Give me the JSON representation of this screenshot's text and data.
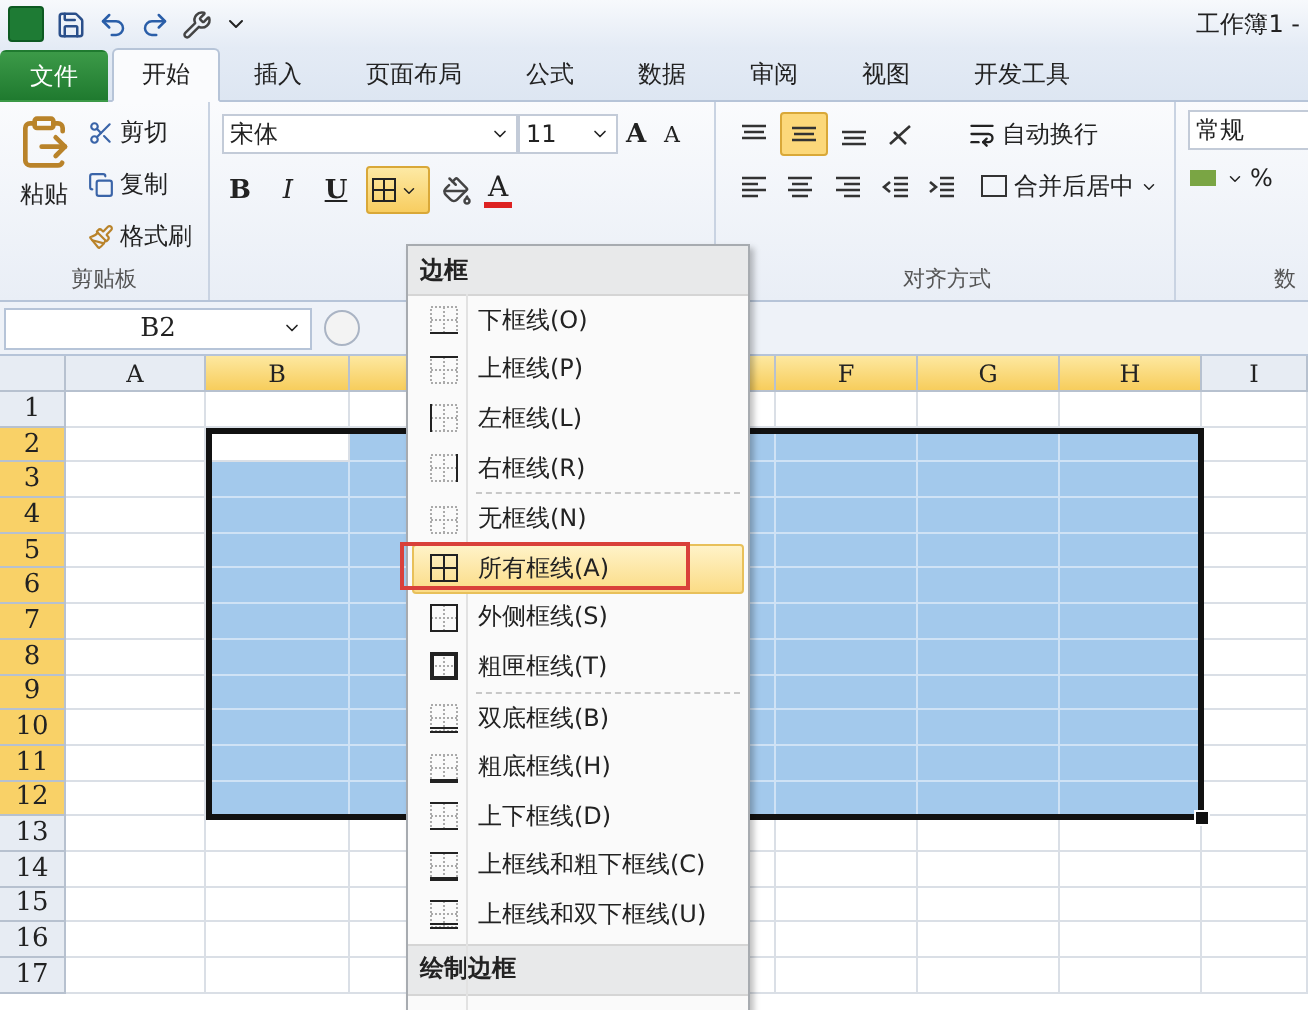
{
  "window": {
    "title": "工作簿1 -"
  },
  "tabs": [
    {
      "label": "文件",
      "kind": "file",
      "selected": false
    },
    {
      "label": "开始",
      "kind": "tab",
      "selected": true
    },
    {
      "label": "插入",
      "kind": "tab",
      "selected": false
    },
    {
      "label": "页面布局",
      "kind": "tab",
      "selected": false
    },
    {
      "label": "公式",
      "kind": "tab",
      "selected": false
    },
    {
      "label": "数据",
      "kind": "tab",
      "selected": false
    },
    {
      "label": "审阅",
      "kind": "tab",
      "selected": false
    },
    {
      "label": "视图",
      "kind": "tab",
      "selected": false
    },
    {
      "label": "开发工具",
      "kind": "tab",
      "selected": false
    }
  ],
  "ribbon": {
    "clipboard": {
      "paste": "粘贴",
      "cut": "剪切",
      "copy": "复制",
      "format_painter": "格式刷",
      "label": "剪贴板"
    },
    "font": {
      "name": "宋体",
      "size": "11",
      "grow": "A",
      "shrink": "A",
      "bold": "B",
      "italic": "I",
      "underline": "U",
      "font_color": "A"
    },
    "alignment": {
      "wrap_text": "自动换行",
      "merge_center": "合并后居中",
      "label": "对齐方式"
    },
    "number": {
      "format": "常规",
      "percent": "%",
      "label": "数"
    }
  },
  "name_box": "B2",
  "columns": [
    {
      "label": "A",
      "selected": false
    },
    {
      "label": "B",
      "selected": true
    },
    {
      "selected": true
    },
    {},
    {
      "selected": true
    },
    {
      "label": "F",
      "selected": true
    },
    {
      "label": "G",
      "selected": true
    },
    {
      "label": "H",
      "selected": true
    },
    {
      "label": "I",
      "selected": false
    }
  ],
  "rows": [
    {
      "label": "1",
      "selected": false
    },
    {
      "label": "2",
      "selected": true
    },
    {
      "label": "3",
      "selected": true
    },
    {
      "label": "4",
      "selected": true
    },
    {
      "label": "5",
      "selected": true
    },
    {
      "label": "6",
      "selected": true
    },
    {
      "label": "7",
      "selected": true
    },
    {
      "label": "8",
      "selected": true
    },
    {
      "label": "9",
      "selected": true
    },
    {
      "label": "10",
      "selected": true
    },
    {
      "label": "11",
      "selected": true
    },
    {
      "label": "12",
      "selected": true
    },
    {
      "label": "13",
      "selected": false
    },
    {
      "label": "14",
      "selected": false
    },
    {
      "label": "15",
      "selected": false
    },
    {
      "label": "16",
      "selected": false
    },
    {
      "label": "17",
      "selected": false
    }
  ],
  "border_menu": {
    "title": "边框",
    "section": "绘制边框",
    "items": [
      {
        "label": "下框线(O)",
        "selected": false,
        "separator_before": false
      },
      {
        "label": "上框线(P)",
        "selected": false,
        "separator_before": false
      },
      {
        "label": "左框线(L)",
        "selected": false,
        "separator_before": false
      },
      {
        "label": "右框线(R)",
        "selected": false,
        "separator_before": false
      },
      {
        "label": "无框线(N)",
        "selected": false,
        "separator_before": true
      },
      {
        "label": "所有框线(A)",
        "selected": true,
        "separator_before": false
      },
      {
        "label": "外侧框线(S)",
        "selected": false,
        "separator_before": false
      },
      {
        "label": "粗匣框线(T)",
        "selected": false,
        "separator_before": false
      },
      {
        "label": "双底框线(B)",
        "selected": false,
        "separator_before": true
      },
      {
        "label": "粗底框线(H)",
        "selected": false,
        "separator_before": false
      },
      {
        "label": "上下框线(D)",
        "selected": false,
        "separator_before": false
      },
      {
        "label": "上框线和粗下框线(C)",
        "selected": false,
        "separator_before": false
      },
      {
        "label": "上框线和双下框线(U)",
        "selected": false,
        "separator_before": false
      }
    ]
  }
}
